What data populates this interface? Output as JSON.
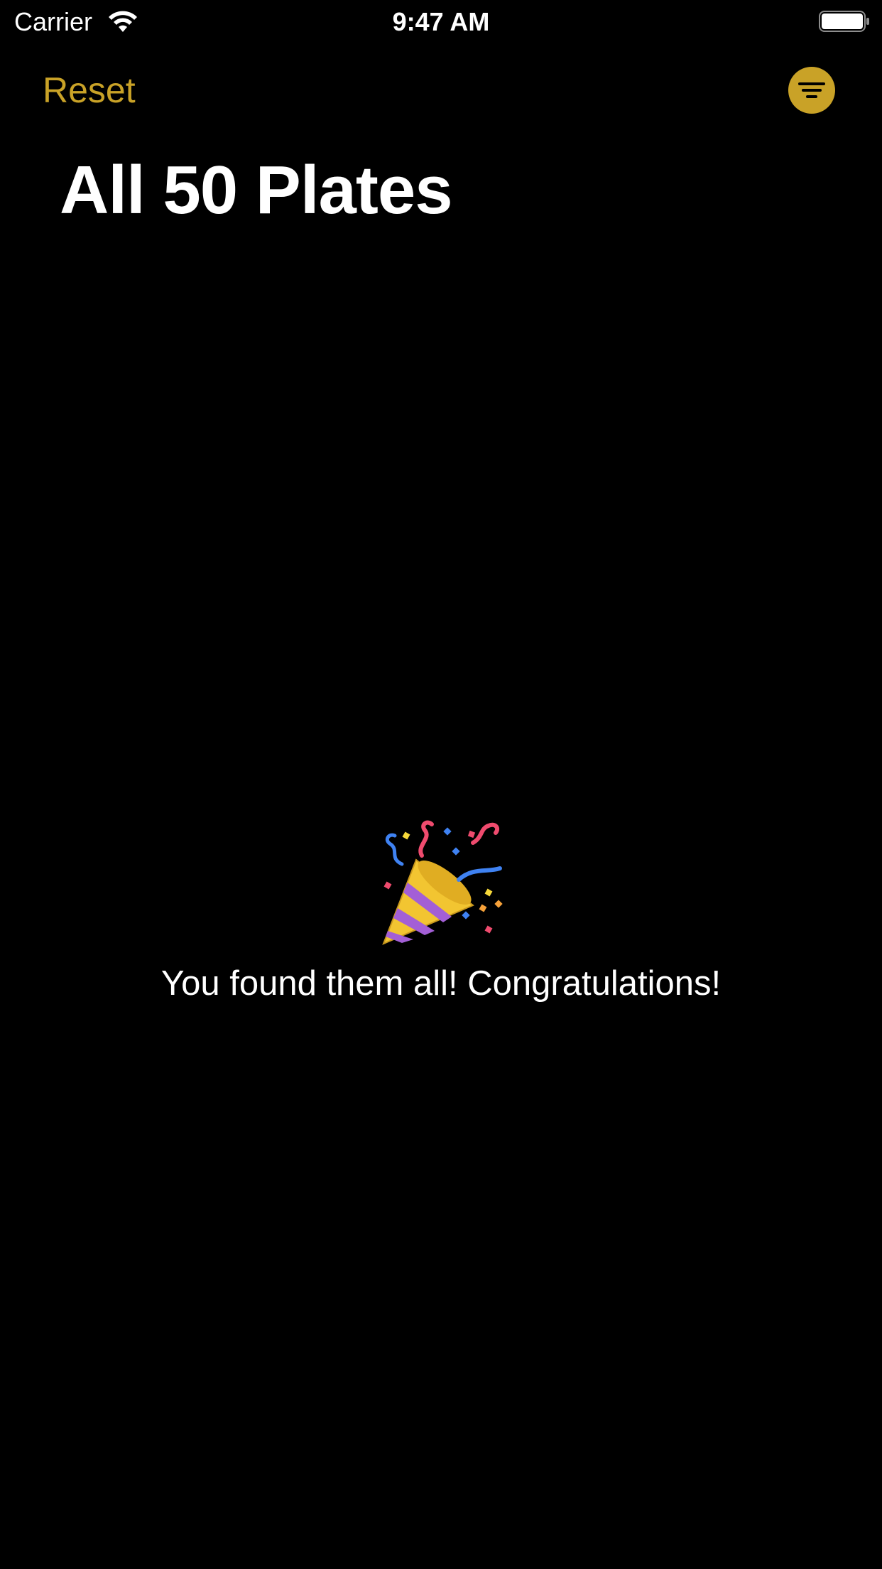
{
  "status_bar": {
    "carrier": "Carrier",
    "time": "9:47 AM",
    "icons": [
      "wifi-icon",
      "battery-icon"
    ]
  },
  "nav": {
    "reset_label": "Reset",
    "filter_icon": "filter-icon",
    "title": "All 50 Plates"
  },
  "empty_state": {
    "icon": "party-popper-icon",
    "message": "You found them all! Congratulations!"
  },
  "colors": {
    "background": "#000000",
    "accent": "#c9a227",
    "text": "#ffffff"
  }
}
